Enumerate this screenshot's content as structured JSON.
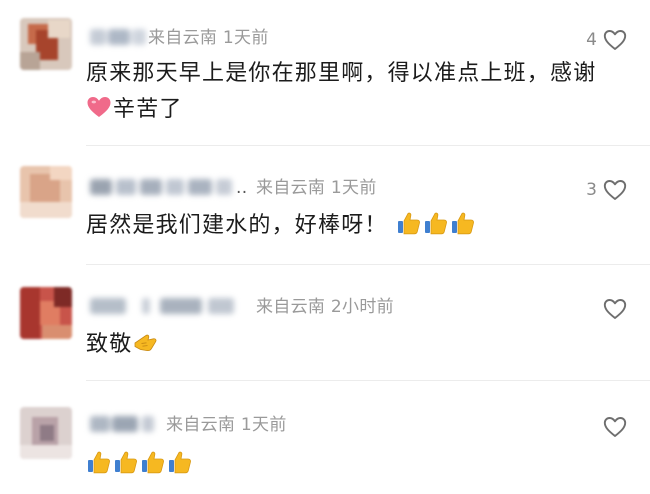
{
  "comments": [
    {
      "location": "来自云南",
      "time": "1天前",
      "likes": "4",
      "text_part1": "原来那天早上是你在那里啊，得以准点上班，感谢",
      "text_part2": "辛苦了",
      "emoji": "pink-heart-icon"
    },
    {
      "location": "来自云南",
      "time": "1天前",
      "likes": "3",
      "text": "居然是我们建水的，好棒呀！",
      "emoji": "thumbs-up-icon",
      "emoji_count": 3
    },
    {
      "location": "来自云南",
      "time": "2小时前",
      "likes": "",
      "text": "致敬",
      "emoji": "saluting-hand-icon"
    },
    {
      "location": "来自云南",
      "time": "1天前",
      "likes": "",
      "text": "",
      "emoji": "thumbs-up-icon",
      "emoji_count": 4
    }
  ],
  "icons": {
    "like": "heart-outline-icon"
  },
  "colors": {
    "meta": "#9a9a9a",
    "text": "#1c1c1c",
    "divider": "#ececec",
    "emoji_heart": "#f06a8a",
    "emoji_thumb": "#f6b821"
  }
}
